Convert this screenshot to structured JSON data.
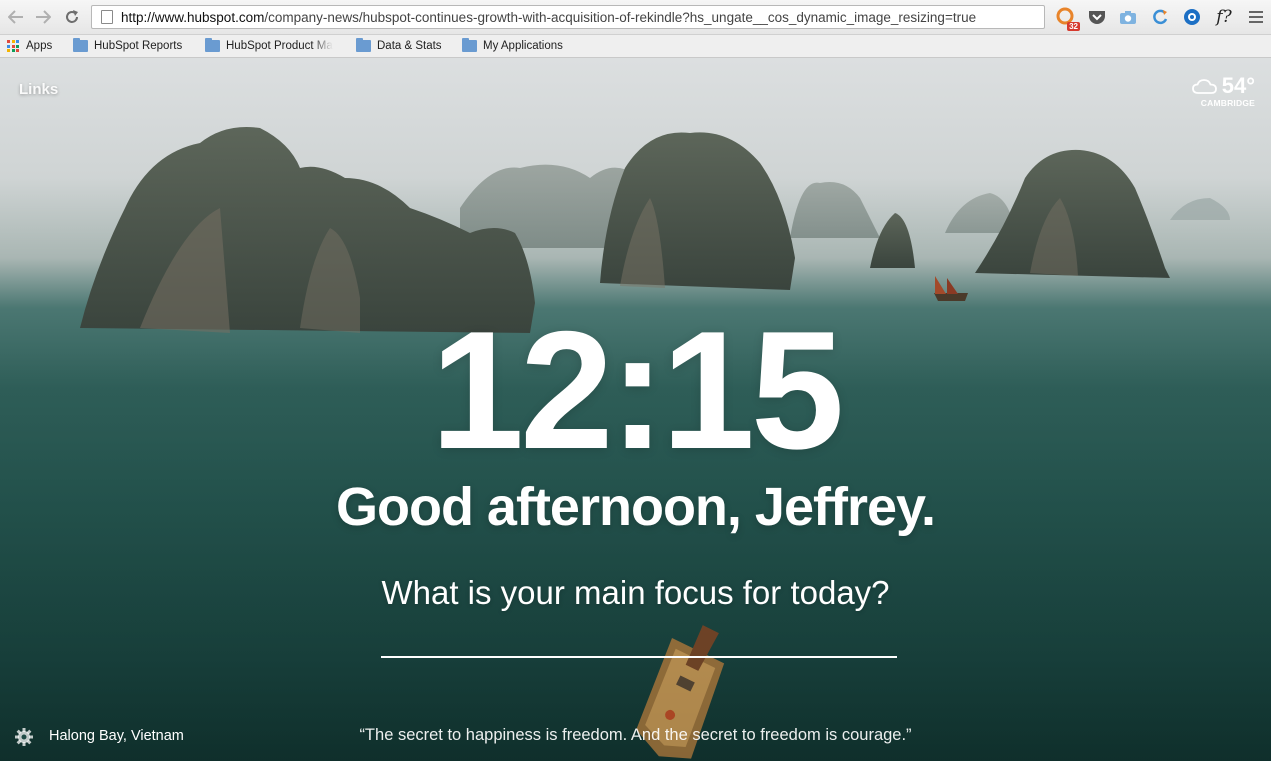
{
  "browser": {
    "url_domain": "http://www.hubspot.com",
    "url_path": "/company-news/hubspot-continues-growth-with-acquisition-of-rekindle?hs_ungate__cos_dynamic_image_resizing=true",
    "extension_badge": "32",
    "extension_f_label": "f?"
  },
  "bookmarks": [
    {
      "label": "Apps"
    },
    {
      "label": "HubSpot Reports"
    },
    {
      "label": "HubSpot Product Ma"
    },
    {
      "label": "Data & Stats"
    },
    {
      "label": "My Applications"
    }
  ],
  "dashboard": {
    "links_label": "Links",
    "weather": {
      "temp": "54°",
      "city": "CAMBRIDGE",
      "icon": "partly-cloudy-icon"
    },
    "time": "12:15",
    "greeting": "Good afternoon, Jeffrey.",
    "focus_question": "What is your main focus for today?",
    "focus_value": "",
    "location": "Halong Bay, Vietnam",
    "quote": "“The secret to happiness is freedom. And the secret to freedom is courage.”"
  }
}
